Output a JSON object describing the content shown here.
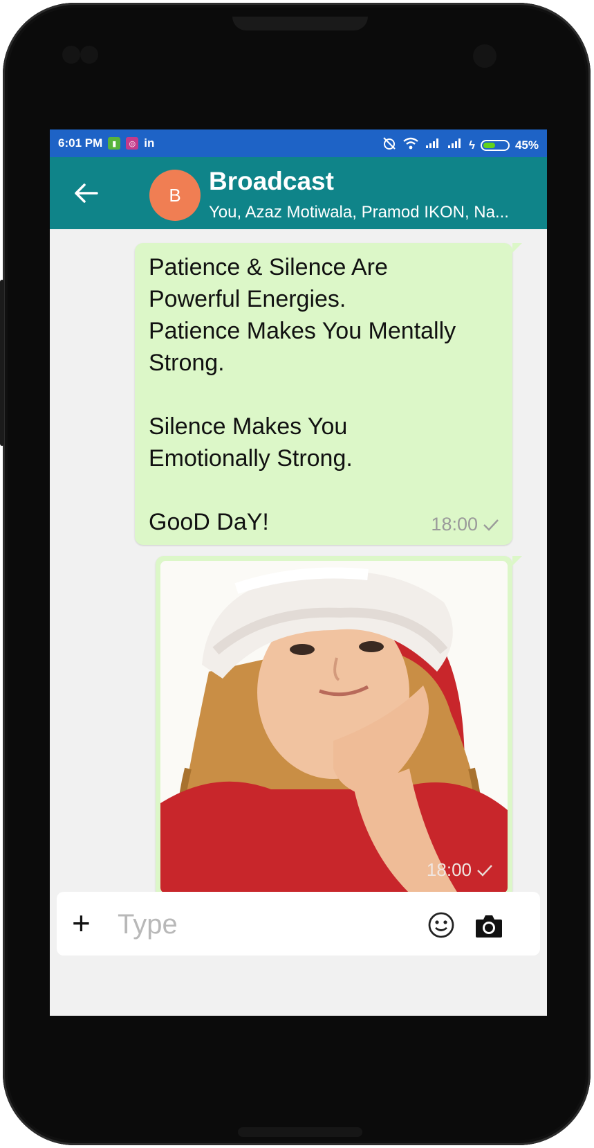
{
  "status_bar": {
    "time": "6:01 PM",
    "left_icons": [
      "sim-toolkit-icon",
      "instagram-icon",
      "linkedin-icon"
    ],
    "linkedin_label": "in",
    "right_icons": [
      "alarm-muted-icon",
      "wifi-icon",
      "signal-icon",
      "signal-icon",
      "charging-icon",
      "battery-icon"
    ],
    "battery_percent": "45%"
  },
  "header": {
    "avatar_letter": "B",
    "title": "Broadcast",
    "subtitle": "You, Azaz Motiwala, Pramod IKON, Na..."
  },
  "messages": [
    {
      "type": "text",
      "text": "Patience & Silence Are\nPowerful Energies.\nPatience Makes You Mentally\nStrong.\n\nSilence Makes You\nEmotionally Strong.\n\nGooD DaY!",
      "time": "18:00",
      "status": "sent"
    },
    {
      "type": "image",
      "image_description_icon": "photo-girl-santa-hat",
      "time": "18:00",
      "status": "sent"
    }
  ],
  "composer": {
    "placeholder": "Type",
    "plus_label": "+"
  },
  "colors": {
    "status_bar": "#1e63c6",
    "app_bar": "#0f8489",
    "avatar": "#f07e53",
    "bubble": "#dcf7c8",
    "chat_background": "#f1f1f1"
  }
}
